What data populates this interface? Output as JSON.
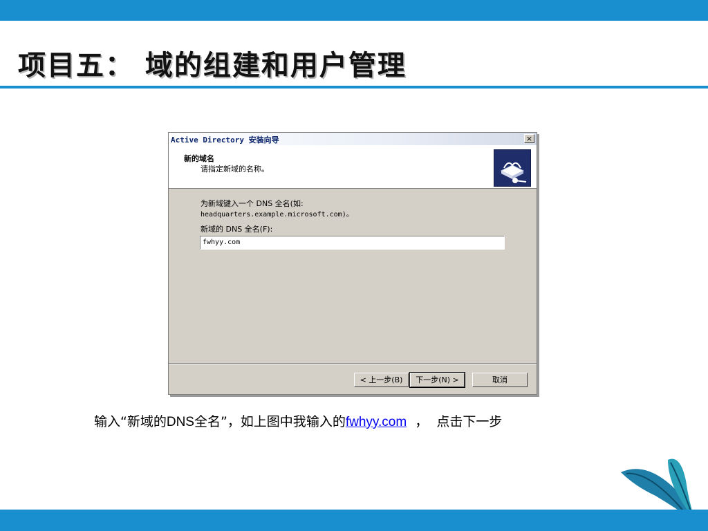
{
  "slide": {
    "title": "项目五： 域的组建和用户管理"
  },
  "dialog": {
    "title": "Active Directory 安装向导",
    "close_label": "×",
    "header_title": "新的域名",
    "header_subtitle": "请指定新域的名称。",
    "instruction_line1": "为新域键入一个 DNS 全名(如:",
    "instruction_line2": "headquarters.example.microsoft.com)。",
    "field_label": "新域的 DNS 全名(F):",
    "field_value": "fwhyy.com",
    "buttons": {
      "back": "< 上一步(B)",
      "next": "下一步(N) >",
      "cancel": "取消"
    }
  },
  "caption": {
    "part1": "输入“新域的",
    "part2": "DNS",
    "part3": "全名”，如上图中我输入的",
    "link": "fwhyy.com",
    "part4": "  ，  点击下一步"
  },
  "colors": {
    "accent": "#1a8fd0",
    "dialog_face": "#d4d0c8",
    "link": "#0000ee"
  }
}
